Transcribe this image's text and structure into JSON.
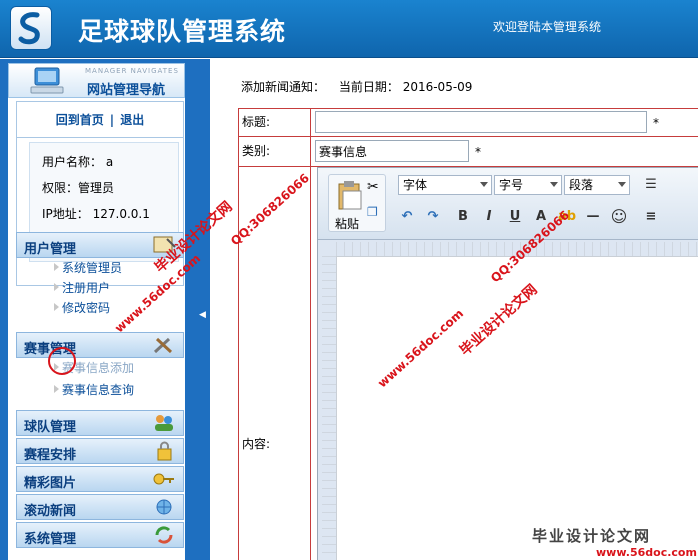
{
  "header": {
    "title": "足球球队管理系统",
    "welcome": "欢迎登陆本管理系统"
  },
  "sidebar": {
    "nav_en": "MANAGER NAVIGATES",
    "nav_cn": "网站管理导航",
    "links": {
      "home": "回到首页",
      "sep": "|",
      "logout": "退出"
    },
    "user": {
      "name_label": "用户名称：",
      "name_value": "a",
      "role_label": "权限：",
      "role_value": "管理员",
      "ip_label": "IP地址：",
      "ip_value": "127.0.0.1"
    },
    "groups": [
      {
        "title": "用户管理",
        "items": [
          "系统管理员",
          "注册用户",
          "修改密码"
        ]
      },
      {
        "title": "赛事管理",
        "items": [
          "赛事信息添加",
          "赛事信息查询"
        ]
      },
      {
        "title": "球队管理",
        "items": []
      },
      {
        "title": "赛程安排",
        "items": []
      },
      {
        "title": "精彩图片",
        "items": []
      },
      {
        "title": "滚动新闻",
        "items": []
      },
      {
        "title": "系统管理",
        "items": []
      }
    ]
  },
  "main": {
    "crumb": "添加新闻通知：",
    "date_label": "当前日期：",
    "date_value": "2016-05-09",
    "form": {
      "title_label": "标题:",
      "title_value": "",
      "category_label": "类别:",
      "category_value": "赛事信息",
      "required_mark": "*",
      "content_label": "内容:"
    },
    "editor": {
      "paste_label": "粘贴",
      "font_select": "字体",
      "size_select": "字号",
      "para_select": "段落",
      "bold": "B",
      "italic": "I",
      "underline": "U"
    }
  },
  "watermarks": {
    "site_cn": "毕业设计论文网",
    "qq": "QQ:306826066",
    "url": "www.56doc.com",
    "footer_url": "www.56doc.com"
  },
  "colors": {
    "header_bg": "#1a83cf",
    "sidebar_bg": "#1e6fc0",
    "form_border": "#c63c3c",
    "watermark": "#d9141b"
  }
}
